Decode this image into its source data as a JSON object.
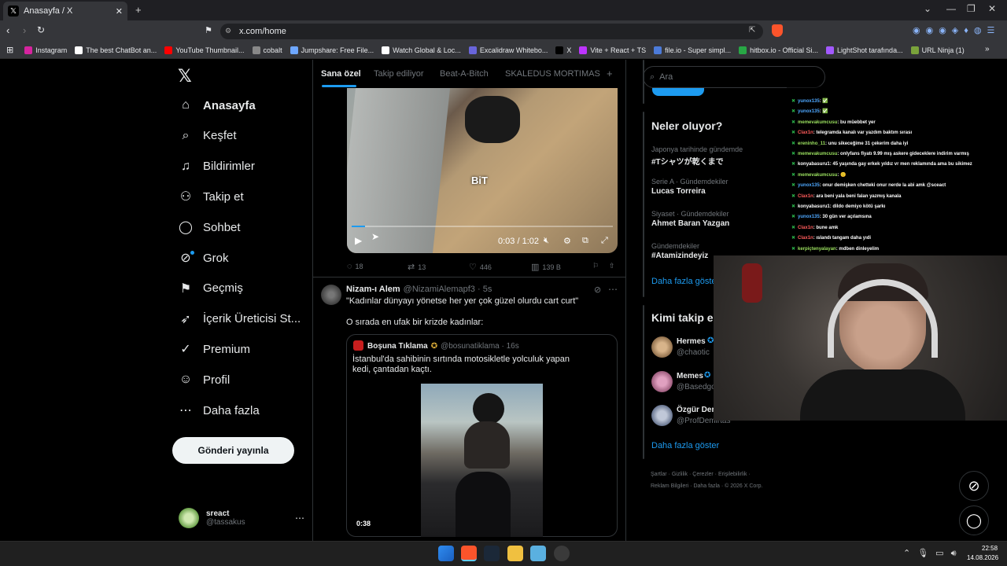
{
  "browser": {
    "tab_title": "Anasayfa / X",
    "url": "x.com/home",
    "bookmarks": [
      {
        "label": "Instagram",
        "color": "#d6249f"
      },
      {
        "label": "The best ChatBot an...",
        "color": "#ffffff"
      },
      {
        "label": "YouTube Thumbnail...",
        "color": "#ff0000"
      },
      {
        "label": "cobalt",
        "color": "#888888"
      },
      {
        "label": "Jumpshare: Free File...",
        "color": "#6ea7ff"
      },
      {
        "label": "Watch Global & Loc...",
        "color": "#ffffff"
      },
      {
        "label": "Excalidraw Whitebo...",
        "color": "#6965db"
      },
      {
        "label": "X",
        "color": "#000000"
      },
      {
        "label": "Vite + React + TS",
        "color": "#bd34fe"
      },
      {
        "label": "file.io - Super simpl...",
        "color": "#4c7bd9"
      },
      {
        "label": "hitbox.io - Official Si...",
        "color": "#28a745"
      },
      {
        "label": "LightShot tarafında...",
        "color": "#a259ff"
      },
      {
        "label": "URL Ninja (1)",
        "color": "#7aa33b"
      }
    ]
  },
  "nav": {
    "items": [
      {
        "label": "Anasayfa",
        "icon": "home-icon",
        "glyph": "⌂"
      },
      {
        "label": "Keşfet",
        "icon": "search-icon",
        "glyph": "⌕"
      },
      {
        "label": "Bildirimler",
        "icon": "bell-icon",
        "glyph": "♫"
      },
      {
        "label": "Takip et",
        "icon": "person-add-icon",
        "glyph": "⚇"
      },
      {
        "label": "Sohbet",
        "icon": "chat-icon",
        "glyph": "◯"
      },
      {
        "label": "Grok",
        "icon": "grok-icon",
        "glyph": "⊘"
      },
      {
        "label": "Geçmiş",
        "icon": "bookmark-icon",
        "glyph": "⚑"
      },
      {
        "label": "İçerik Üreticisi St...",
        "icon": "rocket-icon",
        "glyph": "➶"
      },
      {
        "label": "Premium",
        "icon": "verified-icon",
        "glyph": "✓"
      },
      {
        "label": "Profil",
        "icon": "profile-icon",
        "glyph": "☺"
      },
      {
        "label": "Daha fazla",
        "icon": "more-icon",
        "glyph": "⋯"
      }
    ],
    "post_button": "Gönderi yayınla",
    "account": {
      "name": "sreact",
      "handle": "@tassakus"
    }
  },
  "feed": {
    "tabs": [
      "Sana özel",
      "Takip ediliyor",
      "Beat-A-Bitch",
      "SKALEDUS MORTIMAS"
    ],
    "video": {
      "time": "0:03 / 1:02",
      "watermark": "BiT",
      "progress": 0.05
    },
    "metrics": {
      "replies": "18",
      "reposts": "13",
      "likes": "446",
      "views": "139 B"
    },
    "tweet": {
      "name": "Nizam-ı Alem",
      "handle": "@NizamiAlemapf3 · 5s",
      "text1": "\"Kadınlar dünyayı yönetse her yer çok güzel olurdu cart curt\"",
      "text2": "O sırada en ufak bir krizde kadınlar:"
    },
    "quote": {
      "name": "Boşuna Tıklama",
      "handle": "@bosunatiklama · 16s",
      "text": "İstanbul'da sahibinin sırtında motosikletle yolculuk yapan kedi, çantadan kaçtı.",
      "duration": "0:38"
    }
  },
  "sidebar": {
    "search_placeholder": "Ara",
    "trends_title": "Neler oluyor?",
    "trends": [
      {
        "meta": "Japonya tarihinde gündemde",
        "name": "#Tシャツが乾くまで"
      },
      {
        "meta": "Serie A · Gündemdekiler",
        "name": "Lucas Torreira"
      },
      {
        "meta": "Siyaset · Gündemdekiler",
        "name": "Ahmet Baran Yazgan"
      },
      {
        "meta": "Gündemdekiler",
        "name": "#Atamizindeyiz"
      }
    ],
    "show_more": "Daha fazla göster",
    "follow_title": "Kimi takip e",
    "follow": [
      {
        "name": "Hermes",
        "handle": "@chaotic"
      },
      {
        "name": "Memes",
        "handle": "@Basedgo"
      },
      {
        "name": "Özgür Der",
        "handle": "@ProfDemirtas"
      }
    ],
    "footer1": "Şartlar · Gizlilik · Çerezler · Erişilebilirlik ·",
    "footer2": "Reklam Bilgileri · Daha fazla · © 2026 X Corp."
  },
  "chat": [
    {
      "user": "yunox135",
      "color": "#4ea8ff",
      "msg": ": ✅"
    },
    {
      "user": "yunox135",
      "color": "#4ea8ff",
      "msg": ": ✅"
    },
    {
      "user": "memevakumcusu",
      "color": "#9be05f",
      "msg": ": bu müebbet yer"
    },
    {
      "user": "Clax1n",
      "color": "#ff5b5b",
      "msg": ": telegramda kanalı var yazdım baktım sırası"
    },
    {
      "user": "ereninho_11",
      "color": "#9be05f",
      "msg": ": unu sikeceğime 31 çekerim daha iyi"
    },
    {
      "user": "memevakumcusu",
      "color": "#9be05f",
      "msg": ": onlyfans fiyatı 9.99 mış askere gideceklere indirim varmış"
    },
    {
      "user": "konyabasuru1",
      "color": "#ffffff",
      "msg": ": 45 yaşında gay erkek yıldız vr men reklamında ama bu sikimez"
    },
    {
      "user": "memevakumcusu",
      "color": "#9be05f",
      "msg": ": 🙂"
    },
    {
      "user": "yunox135",
      "color": "#4ea8ff",
      "msg": ": onur demişken chetteki onur nerde la abi amk @sceact"
    },
    {
      "user": "Clax1n",
      "color": "#ff5b5b",
      "msg": ": ara beni yala beni falan yazmış kanala"
    },
    {
      "user": "konyabasuru1",
      "color": "#ffffff",
      "msg": ": dildo demiyo kötü şarkı"
    },
    {
      "user": "yunox135",
      "color": "#4ea8ff",
      "msg": ": 30 gün ver açılamsına"
    },
    {
      "user": "Clax1n",
      "color": "#ff5b5b",
      "msg": ": bune amk"
    },
    {
      "user": "Clax1n",
      "color": "#ff5b5b",
      "msg": ": ıslandı tangam daha yıdi"
    },
    {
      "user": "kerpiçtenyalayan",
      "color": "#9be05f",
      "msg": ": mdben dinleyelim"
    }
  ],
  "taskbar": {
    "time": "22:58",
    "date": "14.08.2026"
  }
}
